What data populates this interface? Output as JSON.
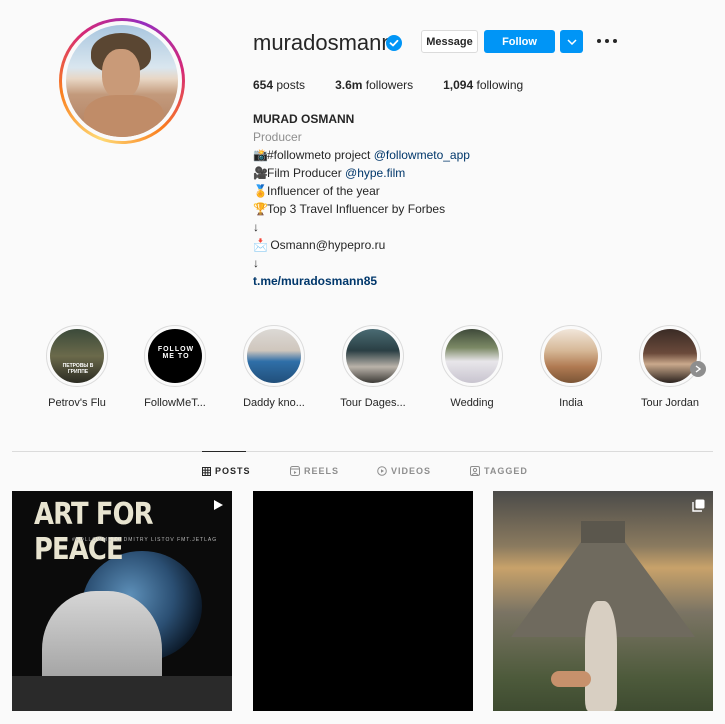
{
  "profile": {
    "username": "muradosmann",
    "verified": true,
    "message_label": "Message",
    "follow_label": "Follow"
  },
  "stats": {
    "posts": "654",
    "posts_label": "posts",
    "followers": "3.6m",
    "followers_label": "followers",
    "following": "1,094",
    "following_label": "following"
  },
  "bio": {
    "full_name": "MURAD OSMANN",
    "category": "Producer",
    "line1_text": "#followmeto project ",
    "line1_tag": "@followmeto_app",
    "line2_text": "Film Producer ",
    "line2_tag": "@hype.film",
    "line3_text": "Influencer of the year",
    "line4_text": "Top 3 Travel Influencer by Forbes",
    "arrow1": "↓",
    "line5_text": "Osmann@hypepro.ru",
    "arrow2": "↓",
    "link": "t.me/muradosmann85"
  },
  "highlights": [
    {
      "label": "Petrov's Flu",
      "caption": "ПЕТРОВЫ В ГРИППЕ"
    },
    {
      "label": "FollowMeT...",
      "caption": "FOLLOW ME TO"
    },
    {
      "label": "Daddy kno..."
    },
    {
      "label": "Tour Dages..."
    },
    {
      "label": "Wedding"
    },
    {
      "label": "India"
    },
    {
      "label": "Tour Jordan"
    }
  ],
  "tabs": {
    "posts": "POSTS",
    "reels": "REELS",
    "videos": "VIDEOS",
    "tagged": "TAGGED"
  },
  "posts": [
    {
      "headline": "ART FOR PEACE",
      "credits": "#FOLLOWMETO   DMITRY LISTOV   FMT.JETLAG",
      "type": "reel"
    },
    {
      "type": "image"
    },
    {
      "type": "carousel"
    }
  ],
  "colors": {
    "accent": "#0095f6",
    "link": "#00376b",
    "muted": "#8e8e8e",
    "text": "#262626"
  }
}
